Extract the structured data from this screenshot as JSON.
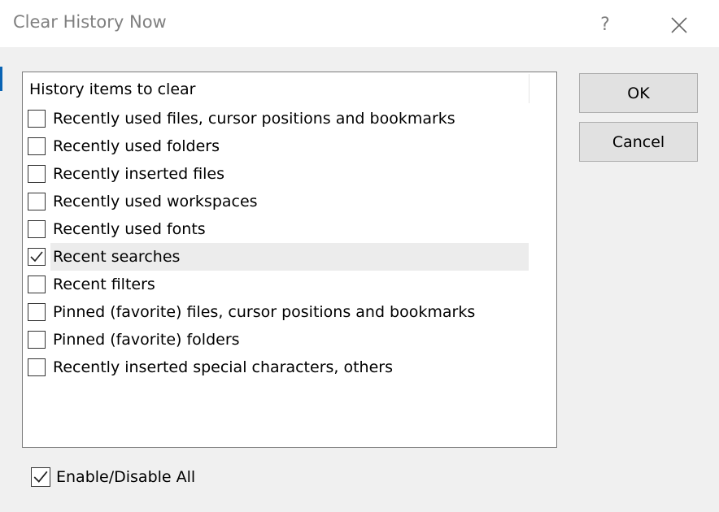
{
  "dialog": {
    "title": "Clear History Now",
    "help_icon": "question-mark-icon",
    "help_glyph": "?",
    "close_icon": "close-x-icon"
  },
  "list": {
    "header": "History items to clear",
    "items": [
      {
        "label": "Recently used files, cursor positions and bookmarks",
        "checked": false
      },
      {
        "label": "Recently used folders",
        "checked": false
      },
      {
        "label": "Recently inserted files",
        "checked": false
      },
      {
        "label": "Recently used workspaces",
        "checked": false
      },
      {
        "label": "Recently used fonts",
        "checked": false
      },
      {
        "label": "Recent searches",
        "checked": true,
        "selected": true
      },
      {
        "label": "Recent filters",
        "checked": false
      },
      {
        "label": "Pinned (favorite) files, cursor positions and bookmarks",
        "checked": false
      },
      {
        "label": "Pinned (favorite) folders",
        "checked": false
      },
      {
        "label": "Recently inserted special characters, others",
        "checked": false
      }
    ]
  },
  "buttons": {
    "ok_label": "OK",
    "cancel_label": "Cancel"
  },
  "toggle_all": {
    "label": "Enable/Disable All",
    "checked": true
  },
  "colors": {
    "accent": "#0a64b4",
    "title_text": "#808080",
    "selection": "#ececec"
  }
}
